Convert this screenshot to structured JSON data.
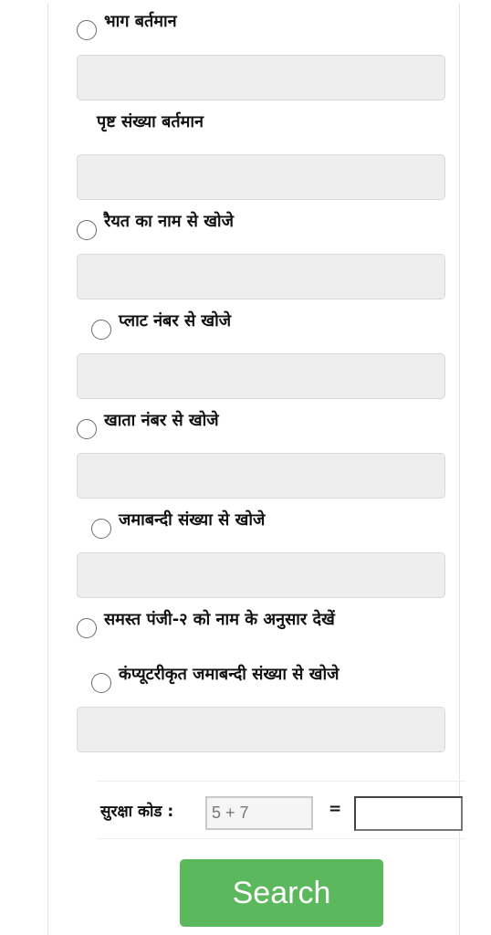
{
  "form": {
    "options": [
      {
        "label": "भाग बर्तमान",
        "has_radio": true,
        "input_value": ""
      },
      {
        "label": "पृष्ट संख्या बर्तमान",
        "has_radio": false,
        "input_value": ""
      },
      {
        "label": "रैयत का नाम से खोजे",
        "has_radio": true,
        "input_value": ""
      },
      {
        "label": "प्लाट नंबर से खोजे",
        "has_radio": true,
        "input_value": ""
      },
      {
        "label": "खाता नंबर से खोजे",
        "has_radio": true,
        "input_value": ""
      },
      {
        "label": "जमाबन्दी संख्या से खोजे",
        "has_radio": true,
        "input_value": ""
      },
      {
        "label": "समस्त पंजी-२ को नाम के अनुसार देखें",
        "has_radio": true
      },
      {
        "label": "कंप्यूटरीकृत जमाबन्दी संख्या से खोजे",
        "has_radio": true,
        "input_value": ""
      }
    ]
  },
  "captcha": {
    "label": "सुरक्षा कोड :",
    "expression": "5 + 7",
    "equals": "=",
    "answer_value": ""
  },
  "search_button": {
    "label": "Search",
    "color": "#5cb85c"
  }
}
